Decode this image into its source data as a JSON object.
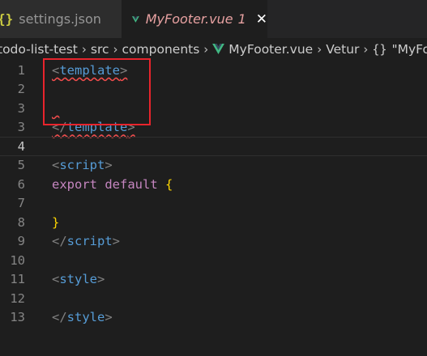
{
  "tabs": [
    {
      "icon": "{}",
      "label": "settings.json",
      "active": false
    },
    {
      "icon": "vue-icon",
      "label": "MyFooter.vue",
      "modified_count": "1",
      "active": true,
      "close": "✕"
    }
  ],
  "breadcrumb": {
    "items": [
      "todo-list-test",
      "src",
      "components",
      "MyFooter.vue",
      "Vetur",
      "\"MyFooter.vue\""
    ],
    "separator": "›",
    "symbol_icon": "{}"
  },
  "editor": {
    "line_numbers": [
      "1",
      "2",
      "3",
      "4",
      "5",
      "6",
      "7",
      "8",
      "9",
      "10",
      "11",
      "12",
      "13"
    ],
    "current_line": "4",
    "lines": {
      "l1": {
        "open": "<",
        "tag": "template",
        "close": ">"
      },
      "l3": {
        "open": "</",
        "tag": "template",
        "close": ">"
      },
      "l5": {
        "open": "<",
        "tag": "script",
        "close": ">"
      },
      "l6": {
        "kw1": "export",
        "kw2": "default",
        "brace": "{"
      },
      "l8": {
        "brace": "}"
      },
      "l9": {
        "open": "</",
        "tag": "script",
        "close": ">"
      },
      "l11": {
        "open": "<",
        "tag": "style",
        "close": ">"
      },
      "l13": {
        "open": "</",
        "tag": "style",
        "close": ">"
      }
    }
  },
  "colors": {
    "annotation_box": "#e8242c",
    "error_squiggle": "#f14c4c",
    "tag": "#569cd6",
    "keyword": "#c586c0",
    "brace": "#ffd700"
  }
}
